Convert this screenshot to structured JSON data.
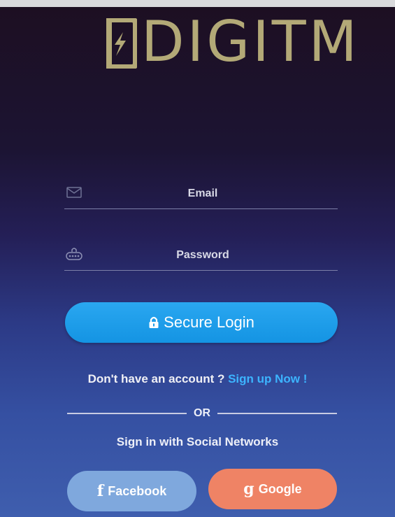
{
  "brand": {
    "logo_text": "DIGITM"
  },
  "login_form": {
    "email_placeholder": "Email",
    "password_placeholder": "Password",
    "secure_login_label": "Secure Login"
  },
  "signup": {
    "prompt": "Don't have an account ?",
    "link": "Sign up Now !"
  },
  "divider": {
    "label": "OR"
  },
  "social": {
    "caption": "Sign in with Social Networks",
    "facebook_label": "Facebook",
    "google_label": "Google",
    "facebook_color": "#7fa8dd",
    "google_color": "#ef8365"
  },
  "colors": {
    "accent": "#1a9ce8",
    "link": "#3cb4ff",
    "logo": "#b3a977"
  },
  "icons": [
    "mail-icon",
    "password-icon",
    "lock-icon",
    "facebook-icon",
    "google-icon"
  ]
}
